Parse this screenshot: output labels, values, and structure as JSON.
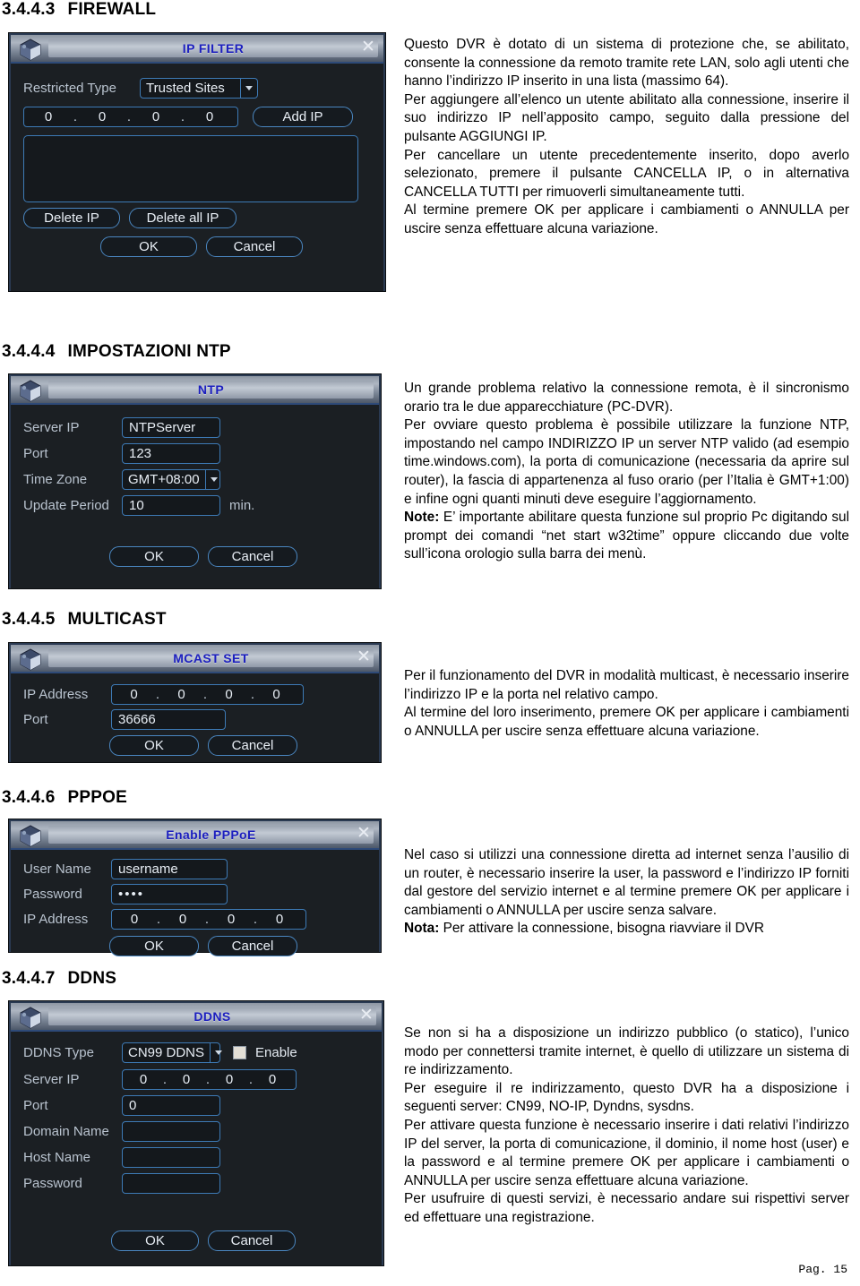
{
  "page": {
    "footer": "Pag. 15"
  },
  "sections": [
    {
      "num": "3.4.4.3",
      "title": "FIREWALL",
      "dialog": {
        "title": "IP FILTER",
        "restricted_type_label": "Restricted Type",
        "restricted_type_value": "Trusted Sites",
        "ip_octets": [
          "0",
          "0",
          "0",
          "0"
        ],
        "add_ip_label": "Add IP",
        "delete_ip_label": "Delete IP",
        "delete_all_ip_label": "Delete all IP",
        "ok_label": "OK",
        "cancel_label": "Cancel"
      },
      "text": [
        "Questo DVR è dotato di un sistema di protezione che, se abilitato, consente la connessione da remoto tramite rete LAN, solo agli utenti che hanno l’indirizzo IP inserito in una lista (massimo 64).",
        "Per aggiungere all’elenco un utente abilitato alla connessione, inserire il suo indirizzo IP nell’apposito campo, seguito dalla pressione del pulsante AGGIUNGI IP.",
        "Per cancellare un utente precedentemente inserito, dopo averlo selezionato, premere il pulsante CANCELLA IP, o in alternativa CANCELLA TUTTI per rimuoverli simultaneamente tutti.",
        "Al termine premere OK per applicare i cambiamenti o ANNULLA per uscire senza effettuare alcuna variazione."
      ]
    },
    {
      "num": "3.4.4.4",
      "title": "IMPOSTAZIONI NTP",
      "dialog": {
        "title": "NTP",
        "server_ip_label": "Server IP",
        "server_ip_value": "NTPServer",
        "port_label": "Port",
        "port_value": "123",
        "time_zone_label": "Time Zone",
        "time_zone_value": "GMT+08:00",
        "update_period_label": "Update Period",
        "update_period_value": "10",
        "update_period_unit": "min.",
        "ok_label": "OK",
        "cancel_label": "Cancel"
      },
      "text": [
        "Un grande problema relativo la connessione remota, è il sincronismo orario tra le due apparecchiature (PC-DVR).",
        "Per ovviare questo problema è possibile utilizzare la funzione NTP, impostando nel campo INDIRIZZO IP un server NTP valido (ad esempio time.windows.com), la porta di comunicazione (necessaria da aprire sul router), la fascia di appartenenza al fuso orario (per l’Italia è GMT+1:00) e infine ogni quanti minuti deve eseguire l’aggiornamento."
      ],
      "note_label": "Note:",
      "note_text": " E’ importante abilitare questa funzione sul proprio Pc digitando sul prompt dei comandi “net start w32time” oppure cliccando due volte sull’icona orologio sulla barra dei menù."
    },
    {
      "num": "3.4.4.5",
      "title": "MULTICAST",
      "dialog": {
        "title": "MCAST SET",
        "ip_address_label": "IP Address",
        "ip_octets": [
          "0",
          "0",
          "0",
          "0"
        ],
        "port_label": "Port",
        "port_value": "36666",
        "ok_label": "OK",
        "cancel_label": "Cancel"
      },
      "text": [
        "Per il funzionamento del DVR in modalità multicast, è necessario inserire l’indirizzo IP e la porta nel relativo campo.",
        "Al termine del loro inserimento, premere OK per applicare i cambiamenti o ANNULLA per uscire senza effettuare alcuna variazione."
      ]
    },
    {
      "num": "3.4.4.6",
      "title": "PPPOE",
      "dialog": {
        "title": "Enable PPPoE",
        "user_name_label": "User Name",
        "user_name_value": "username",
        "password_label": "Password",
        "password_value": "••••",
        "ip_address_label": "IP Address",
        "ip_octets": [
          "0",
          "0",
          "0",
          "0"
        ],
        "ok_label": "OK",
        "cancel_label": "Cancel"
      },
      "text": [
        "Nel caso si utilizzi una connessione diretta ad internet senza l’ausilio di un router, è necessario inserire la user, la password e l’indirizzo IP forniti dal gestore del servizio internet e al termine premere OK per applicare i cambiamenti o ANNULLA per uscire senza salvare."
      ],
      "note_label": "Nota:",
      "note_text": " Per attivare la connessione, bisogna riavviare il DVR"
    },
    {
      "num": "3.4.4.7",
      "title": "DDNS",
      "dialog": {
        "title": "DDNS",
        "ddns_type_label": "DDNS Type",
        "ddns_type_value": "CN99 DDNS",
        "enable_label": "Enable",
        "server_ip_label": "Server IP",
        "ip_octets": [
          "0",
          "0",
          "0",
          "0"
        ],
        "port_label": "Port",
        "port_value": "0",
        "domain_name_label": "Domain Name",
        "domain_name_value": "",
        "host_name_label": "Host Name",
        "host_name_value": "",
        "password_label": "Password",
        "password_value": "",
        "ok_label": "OK",
        "cancel_label": "Cancel"
      },
      "text": [
        "Se non si ha a disposizione un indirizzo pubblico (o statico), l’unico modo per connettersi tramite internet, è quello di utilizzare un sistema di re indirizzamento.",
        "Per eseguire il re indirizzamento, questo DVR ha a disposizione i seguenti server: CN99, NO-IP, Dyndns, sysdns.",
        "Per attivare questa funzione è necessario inserire i dati relativi l’indirizzo IP del server, la porta di comunicazione, il dominio, il nome host (user) e la password e al termine premere OK per applicare i cambiamenti o ANNULLA per uscire senza effettuare alcuna variazione.",
        "Per usufruire di questi servizi, è necessario andare sui rispettivi server ed effettuare una registrazione."
      ]
    }
  ]
}
